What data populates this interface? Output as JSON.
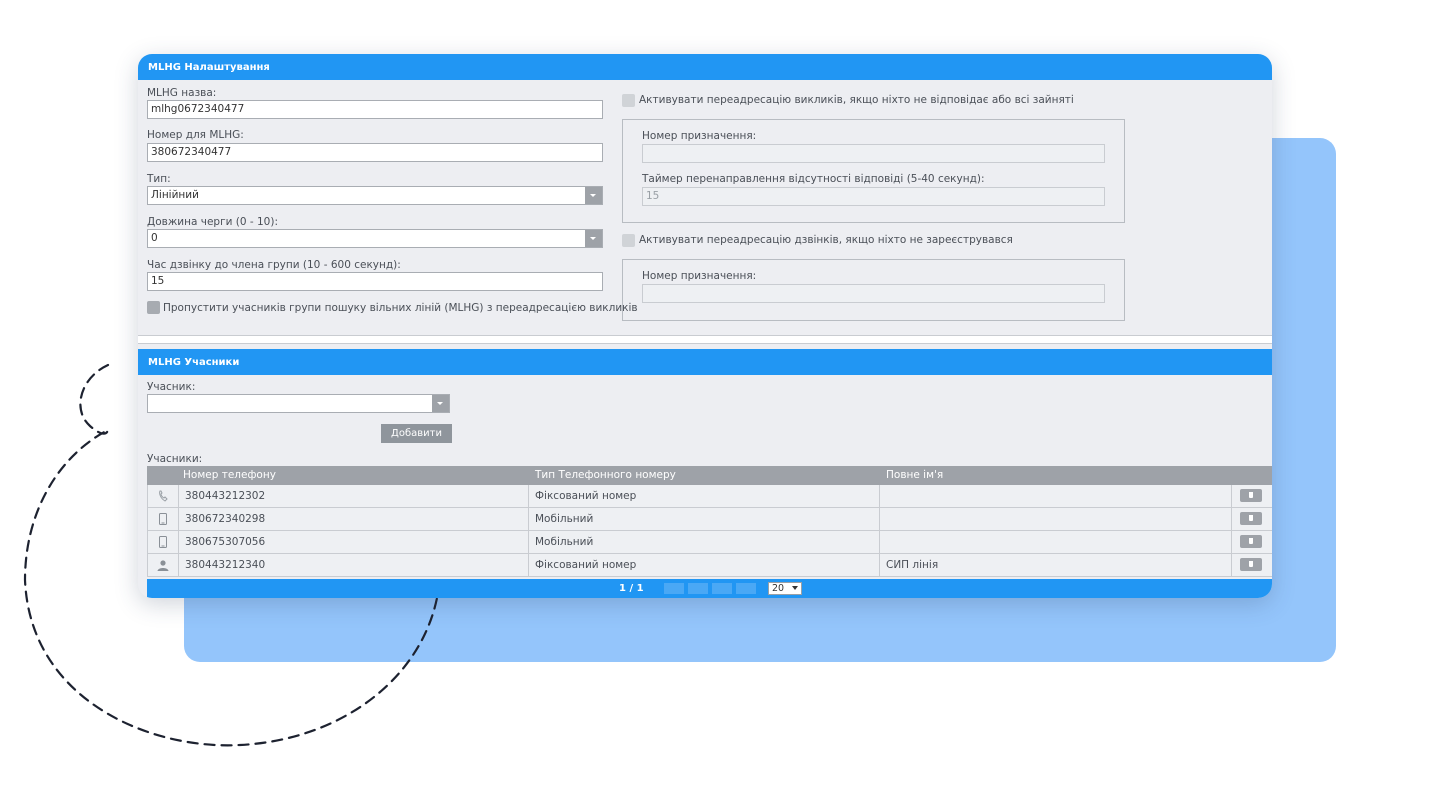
{
  "settings": {
    "title": "MLHG Налаштування",
    "name_label": "MLHG назва:",
    "name_value": "mlhg0672340477",
    "number_label": "Номер для MLHG:",
    "number_value": "380672340477",
    "type_label": "Тип:",
    "type_value": "Лінійний",
    "queue_label": "Довжина черги (0 - 10):",
    "queue_value": "0",
    "ring_label": "Час дзвінку до члена групи (10 - 600 секунд):",
    "ring_value": "15",
    "skip_label": "Пропустити учасників групи пошуку вільних ліній (MLHG) з переадресацією викликів",
    "fwd_busy_label": "Активувати переадресацію викликів, якщо ніхто не відповідає або всі зайняті",
    "fwd_busy_dest_label": "Номер призначення:",
    "fwd_busy_dest_value": "",
    "fwd_timer_label": "Таймер перенаправлення відсутності відповіді (5-40 секунд):",
    "fwd_timer_value": "15",
    "fwd_unreg_label": "Активувати переадресацію дзвінків, якщо ніхто не зареєструвався",
    "fwd_unreg_dest_label": "Номер призначення:",
    "fwd_unreg_dest_value": ""
  },
  "members": {
    "title": "MLHG Учасники",
    "member_label": "Учасник:",
    "member_value": "",
    "add_button": "Добавити",
    "list_label": "Учасники:",
    "columns": [
      "Номер телефону",
      "Тип Телефонного номеру",
      "Повне ім'я"
    ],
    "rows": [
      {
        "icon": "phone-handset-icon",
        "number": "380443212302",
        "type": "Фіксований номер",
        "name": ""
      },
      {
        "icon": "mobile-phone-icon",
        "number": "380672340298",
        "type": "Мобільний",
        "name": ""
      },
      {
        "icon": "mobile-phone-icon",
        "number": "380675307056",
        "type": "Мобільний",
        "name": ""
      },
      {
        "icon": "user-icon",
        "number": "380443212340",
        "type": "Фіксований номер",
        "name": "СИП лінія"
      }
    ],
    "pager": {
      "page_text": "1 / 1",
      "page_size": "20"
    }
  }
}
